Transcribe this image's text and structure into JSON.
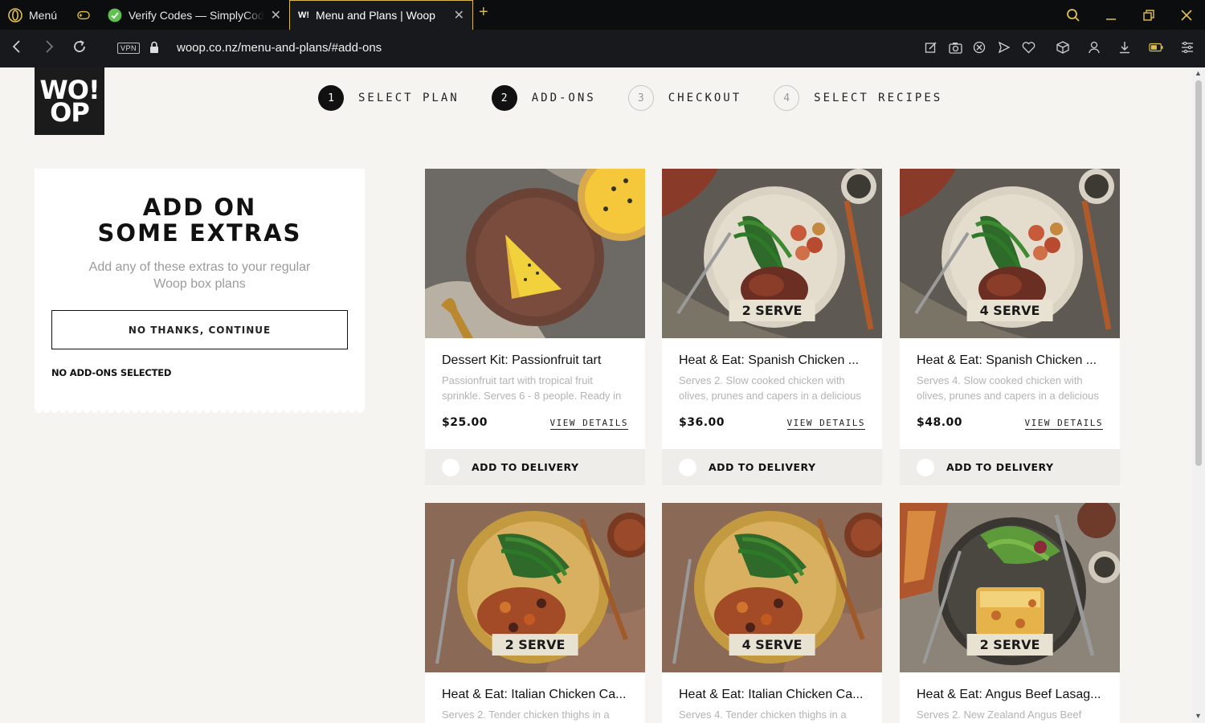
{
  "browser": {
    "tabs": [
      {
        "label": "Menú",
        "active": false
      },
      {
        "label": "Verify Codes — SimplyCodes",
        "active": false
      },
      {
        "label": "Menu and Plans | Woop",
        "active": true
      }
    ],
    "new_tab": "+",
    "url": "woop.co.nz/menu-and-plans/#add-ons",
    "vpn_label": "VPN",
    "accent": "#d6b84b"
  },
  "logo": {
    "line1": "WO!",
    "line2": "OP"
  },
  "steps": [
    {
      "num": "1",
      "label": "SELECT PLAN",
      "state": "done"
    },
    {
      "num": "2",
      "label": "ADD-ONS",
      "state": "current"
    },
    {
      "num": "3",
      "label": "CHECKOUT",
      "state": "todo"
    },
    {
      "num": "4",
      "label": "SELECT RECIPES",
      "state": "todo"
    }
  ],
  "sidebar": {
    "title_line1": "ADD ON",
    "title_line2": "SOME EXTRAS",
    "subtitle": "Add any of these extras to your regular Woop box plans",
    "continue_button": "NO THANKS, CONTINUE",
    "status": "NO ADD-ONS SELECTED"
  },
  "cards": [
    {
      "name": "Dessert Kit: Passionfruit tart",
      "desc": "Passionfruit tart with tropical fruit sprinkle. Serves 6 - 8 people. Ready in",
      "price": "$25.00",
      "serve": "",
      "details": "VIEW DETAILS",
      "add": "ADD TO DELIVERY",
      "image": "tart"
    },
    {
      "name": "Heat & Eat: Spanish Chicken ...",
      "desc": "Serves 2. Slow cooked chicken with olives, prunes and capers in a delicious",
      "price": "$36.00",
      "serve": "2 SERVE",
      "details": "VIEW DETAILS",
      "add": "ADD TO DELIVERY",
      "image": "chicken"
    },
    {
      "name": "Heat & Eat: Spanish Chicken ...",
      "desc": "Serves 4. Slow cooked chicken with olives, prunes and capers in a delicious",
      "price": "$48.00",
      "serve": "4 SERVE",
      "details": "VIEW DETAILS",
      "add": "ADD TO DELIVERY",
      "image": "chicken"
    },
    {
      "name": "Heat & Eat: Italian Chicken Ca...",
      "desc": "Serves 2. Tender chicken thighs in a",
      "price": "",
      "serve": "2 SERVE",
      "details": "",
      "add": "",
      "image": "italian"
    },
    {
      "name": "Heat & Eat: Italian Chicken Ca...",
      "desc": "Serves 4. Tender chicken thighs in a",
      "price": "",
      "serve": "4 SERVE",
      "details": "",
      "add": "",
      "image": "italian"
    },
    {
      "name": "Heat & Eat: Angus Beef Lasag...",
      "desc": "Serves 2. New Zealand Angus Beef",
      "price": "",
      "serve": "2 SERVE",
      "details": "",
      "add": "",
      "image": "lasagne"
    }
  ]
}
